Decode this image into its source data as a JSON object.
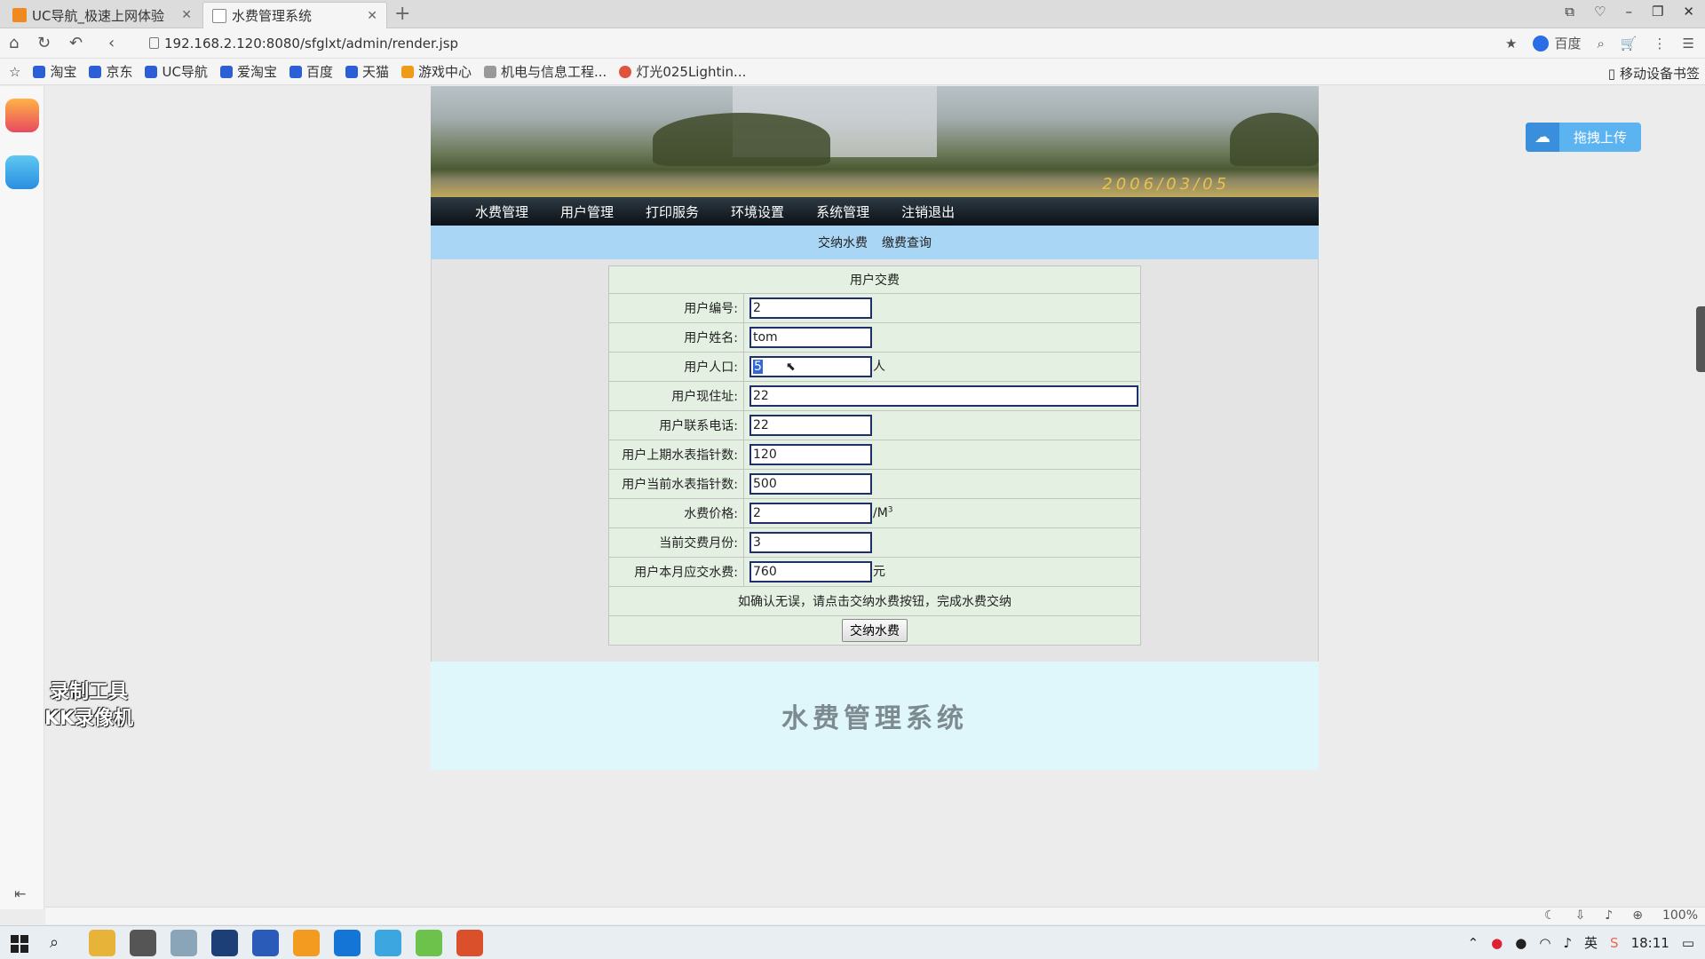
{
  "browser": {
    "tabs": [
      {
        "title": "UC导航_极速上网体验"
      },
      {
        "title": "水费管理系统"
      }
    ],
    "url": "192.168.2.120:8080/sfglxt/admin/render.jsp",
    "search_engine": "百度",
    "bookmarks": [
      "淘宝",
      "京东",
      "UC导航",
      "爱淘宝",
      "百度",
      "天猫",
      "游戏中心",
      "机电与信息工程...",
      "灯光025Lightin..."
    ],
    "mobile_bookmarks": "移动设备书签",
    "zoom": "100%"
  },
  "banner": {
    "date_stamp": "2006/03/05"
  },
  "main_nav": [
    "水费管理",
    "用户管理",
    "打印服务",
    "环境设置",
    "系统管理",
    "注销退出"
  ],
  "sub_nav": [
    "交纳水费",
    "缴费查询"
  ],
  "form": {
    "title": "用户交费",
    "fields": {
      "user_id": {
        "label": "用户编号:",
        "value": "2"
      },
      "user_name": {
        "label": "用户姓名:",
        "value": "tom"
      },
      "population": {
        "label": "用户人口:",
        "value": "5",
        "unit": "人"
      },
      "address": {
        "label": "用户现住址:",
        "value": "22"
      },
      "phone": {
        "label": "用户联系电话:",
        "value": "22"
      },
      "last_meter": {
        "label": "用户上期水表指针数:",
        "value": "120"
      },
      "current_meter": {
        "label": "用户当前水表指针数:",
        "value": "500"
      },
      "price": {
        "label": "水费价格:",
        "value": "2",
        "unit": "/M",
        "unit_sup": "3"
      },
      "month": {
        "label": "当前交费月份:",
        "value": "3"
      },
      "amount_due": {
        "label": "用户本月应交水费:",
        "value": "760",
        "unit": "元"
      }
    },
    "confirm_note": "如确认无误，请点击交纳水费按钮，完成水费交纳",
    "submit_label": "交纳水费"
  },
  "footer_title": "水费管理系统",
  "cloud_upload_label": "拖拽上传",
  "watermark": {
    "line1": "录制工具",
    "line2": "KK录像机"
  },
  "taskbar": {
    "clock": "18:11",
    "ime": "英"
  },
  "colors": {
    "nav_bg": "#0b1116",
    "subnav_bg": "#a9d6f5",
    "form_bg": "#e4f1e2",
    "footer_bg": "#dff7fb",
    "input_border": "#1f2f6a"
  }
}
